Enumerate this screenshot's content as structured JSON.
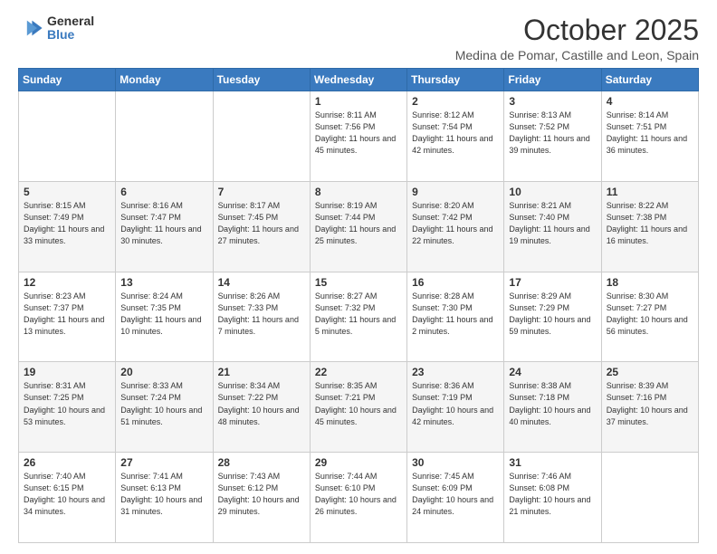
{
  "header": {
    "logo_general": "General",
    "logo_blue": "Blue",
    "title": "October 2025",
    "subtitle": "Medina de Pomar, Castille and Leon, Spain"
  },
  "weekdays": [
    "Sunday",
    "Monday",
    "Tuesday",
    "Wednesday",
    "Thursday",
    "Friday",
    "Saturday"
  ],
  "weeks": [
    [
      {
        "day": "",
        "info": ""
      },
      {
        "day": "",
        "info": ""
      },
      {
        "day": "",
        "info": ""
      },
      {
        "day": "1",
        "info": "Sunrise: 8:11 AM\nSunset: 7:56 PM\nDaylight: 11 hours and 45 minutes."
      },
      {
        "day": "2",
        "info": "Sunrise: 8:12 AM\nSunset: 7:54 PM\nDaylight: 11 hours and 42 minutes."
      },
      {
        "day": "3",
        "info": "Sunrise: 8:13 AM\nSunset: 7:52 PM\nDaylight: 11 hours and 39 minutes."
      },
      {
        "day": "4",
        "info": "Sunrise: 8:14 AM\nSunset: 7:51 PM\nDaylight: 11 hours and 36 minutes."
      }
    ],
    [
      {
        "day": "5",
        "info": "Sunrise: 8:15 AM\nSunset: 7:49 PM\nDaylight: 11 hours and 33 minutes."
      },
      {
        "day": "6",
        "info": "Sunrise: 8:16 AM\nSunset: 7:47 PM\nDaylight: 11 hours and 30 minutes."
      },
      {
        "day": "7",
        "info": "Sunrise: 8:17 AM\nSunset: 7:45 PM\nDaylight: 11 hours and 27 minutes."
      },
      {
        "day": "8",
        "info": "Sunrise: 8:19 AM\nSunset: 7:44 PM\nDaylight: 11 hours and 25 minutes."
      },
      {
        "day": "9",
        "info": "Sunrise: 8:20 AM\nSunset: 7:42 PM\nDaylight: 11 hours and 22 minutes."
      },
      {
        "day": "10",
        "info": "Sunrise: 8:21 AM\nSunset: 7:40 PM\nDaylight: 11 hours and 19 minutes."
      },
      {
        "day": "11",
        "info": "Sunrise: 8:22 AM\nSunset: 7:38 PM\nDaylight: 11 hours and 16 minutes."
      }
    ],
    [
      {
        "day": "12",
        "info": "Sunrise: 8:23 AM\nSunset: 7:37 PM\nDaylight: 11 hours and 13 minutes."
      },
      {
        "day": "13",
        "info": "Sunrise: 8:24 AM\nSunset: 7:35 PM\nDaylight: 11 hours and 10 minutes."
      },
      {
        "day": "14",
        "info": "Sunrise: 8:26 AM\nSunset: 7:33 PM\nDaylight: 11 hours and 7 minutes."
      },
      {
        "day": "15",
        "info": "Sunrise: 8:27 AM\nSunset: 7:32 PM\nDaylight: 11 hours and 5 minutes."
      },
      {
        "day": "16",
        "info": "Sunrise: 8:28 AM\nSunset: 7:30 PM\nDaylight: 11 hours and 2 minutes."
      },
      {
        "day": "17",
        "info": "Sunrise: 8:29 AM\nSunset: 7:29 PM\nDaylight: 10 hours and 59 minutes."
      },
      {
        "day": "18",
        "info": "Sunrise: 8:30 AM\nSunset: 7:27 PM\nDaylight: 10 hours and 56 minutes."
      }
    ],
    [
      {
        "day": "19",
        "info": "Sunrise: 8:31 AM\nSunset: 7:25 PM\nDaylight: 10 hours and 53 minutes."
      },
      {
        "day": "20",
        "info": "Sunrise: 8:33 AM\nSunset: 7:24 PM\nDaylight: 10 hours and 51 minutes."
      },
      {
        "day": "21",
        "info": "Sunrise: 8:34 AM\nSunset: 7:22 PM\nDaylight: 10 hours and 48 minutes."
      },
      {
        "day": "22",
        "info": "Sunrise: 8:35 AM\nSunset: 7:21 PM\nDaylight: 10 hours and 45 minutes."
      },
      {
        "day": "23",
        "info": "Sunrise: 8:36 AM\nSunset: 7:19 PM\nDaylight: 10 hours and 42 minutes."
      },
      {
        "day": "24",
        "info": "Sunrise: 8:38 AM\nSunset: 7:18 PM\nDaylight: 10 hours and 40 minutes."
      },
      {
        "day": "25",
        "info": "Sunrise: 8:39 AM\nSunset: 7:16 PM\nDaylight: 10 hours and 37 minutes."
      }
    ],
    [
      {
        "day": "26",
        "info": "Sunrise: 7:40 AM\nSunset: 6:15 PM\nDaylight: 10 hours and 34 minutes."
      },
      {
        "day": "27",
        "info": "Sunrise: 7:41 AM\nSunset: 6:13 PM\nDaylight: 10 hours and 31 minutes."
      },
      {
        "day": "28",
        "info": "Sunrise: 7:43 AM\nSunset: 6:12 PM\nDaylight: 10 hours and 29 minutes."
      },
      {
        "day": "29",
        "info": "Sunrise: 7:44 AM\nSunset: 6:10 PM\nDaylight: 10 hours and 26 minutes."
      },
      {
        "day": "30",
        "info": "Sunrise: 7:45 AM\nSunset: 6:09 PM\nDaylight: 10 hours and 24 minutes."
      },
      {
        "day": "31",
        "info": "Sunrise: 7:46 AM\nSunset: 6:08 PM\nDaylight: 10 hours and 21 minutes."
      },
      {
        "day": "",
        "info": ""
      }
    ]
  ]
}
